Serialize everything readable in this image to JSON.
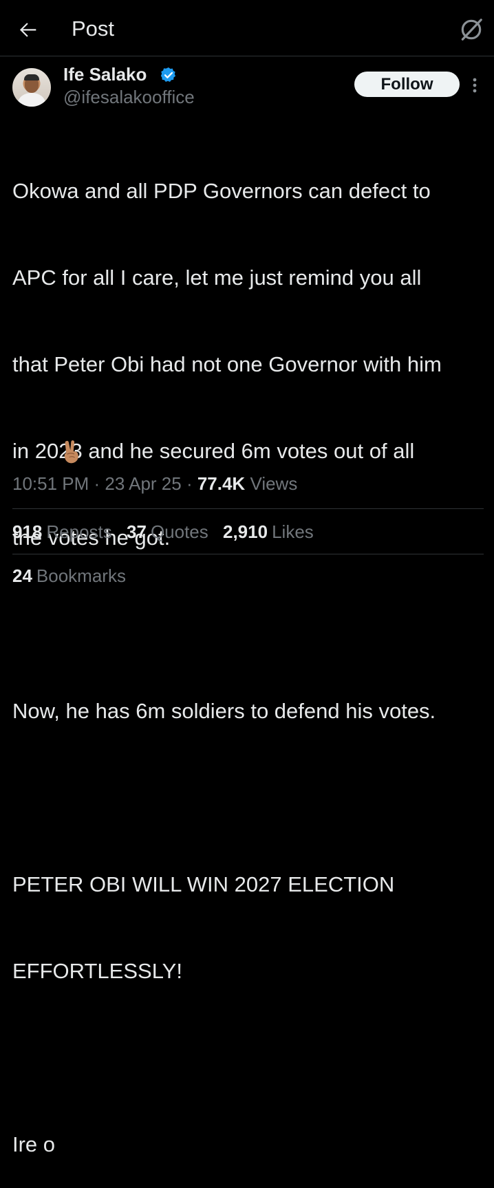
{
  "header": {
    "title": "Post",
    "back_icon": "arrow-left-icon",
    "right_icon": "grok-slash-icon"
  },
  "author": {
    "name": "Ife Salako",
    "handle": "@ifesalakooffice",
    "verified": true,
    "verified_color": "#1d9bf0"
  },
  "follow_label": "Follow",
  "post": {
    "lines": [
      "Okowa and all PDP Governors can defect to",
      "APC for all I care, let me just remind you all",
      "that Peter Obi had not one Governor with him",
      "in 2023 and he secured 6m votes out of all",
      "the votes he got.",
      "",
      "Now, he has 6m soldiers to defend his votes.",
      "",
      "PETER OBI WILL WIN 2027 ELECTION",
      "EFFORTLESSLY!",
      "",
      "Ire o"
    ],
    "emoji": "victory-hand-emoji"
  },
  "meta": {
    "time": "10:51 PM",
    "sep1": " · ",
    "date": "23 Apr 25",
    "sep2": " · ",
    "views_count": "77.4K",
    "views_label": "Views"
  },
  "stats": {
    "reposts_count": "918",
    "reposts_label": "Reposts",
    "quotes_count": "37",
    "quotes_label": "Quotes",
    "likes_count": "2,910",
    "likes_label": "Likes",
    "bookmarks_count": "24",
    "bookmarks_label": "Bookmarks"
  },
  "colors": {
    "background": "#000000",
    "text": "#e7e9ea",
    "muted": "#71767b",
    "divider": "#2f3336",
    "button_bg": "#eff3f4"
  }
}
